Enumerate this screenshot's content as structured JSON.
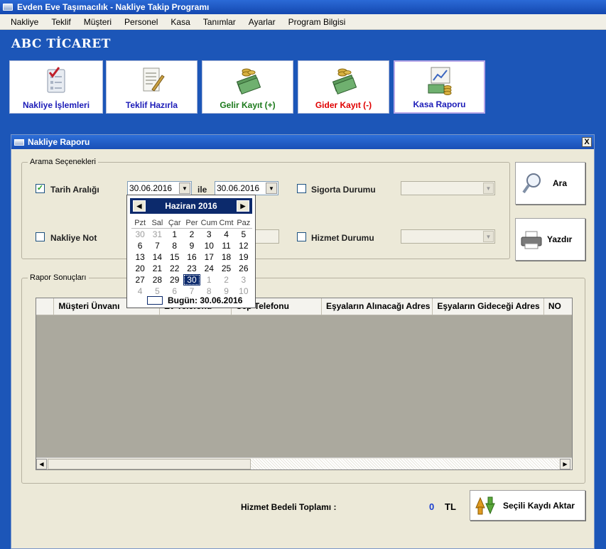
{
  "window": {
    "title": "Evden Eve Taşımacılık - Nakliye Takip Programı"
  },
  "menu": [
    "Nakliye",
    "Teklif",
    "Müşteri",
    "Personel",
    "Kasa",
    "Tanımlar",
    "Ayarlar",
    "Program Bilgisi"
  ],
  "company": "ABC TİCARET",
  "toolbar": [
    {
      "label": "Nakliye İşlemleri",
      "color": "#1c1cb8",
      "icon": "checklist-icon"
    },
    {
      "label": "Teklif Hazırla",
      "color": "#1c1cb8",
      "icon": "document-pen-icon"
    },
    {
      "label": "Gelir Kayıt (+)",
      "color": "#1c7a1c",
      "icon": "money-coins-icon"
    },
    {
      "label": "Gider Kayıt (-)",
      "color": "#e00000",
      "icon": "money-coins-icon"
    },
    {
      "label": "Kasa Raporu",
      "color": "#1c1cb8",
      "icon": "money-chart-icon"
    }
  ],
  "dialog": {
    "title": "Nakliye Raporu",
    "close": "X",
    "search_group": "Arama Seçenekleri",
    "date_range": {
      "label": "Tarih Aralığı",
      "checked": true,
      "from": "30.06.2016",
      "connector": "ile",
      "to": "30.06.2016"
    },
    "insurance": {
      "label": "Sigorta Durumu",
      "checked": false
    },
    "note": {
      "label": "Nakliye Not",
      "checked": false
    },
    "service": {
      "label": "Hizmet Durumu",
      "checked": false
    },
    "search_button": "Ara",
    "print_button": "Yazdır",
    "results_group": "Rapor Sonuçları",
    "columns": [
      "Müşteri Ünvanı",
      "Ev Telefonu",
      "Cep Telefonu",
      "Eşyaların Alınacağı Adres",
      "Eşyaların Gideceği Adres",
      "NO"
    ],
    "total_label": "Hizmet Bedeli Toplamı :",
    "total_value": "0",
    "currency": "TL",
    "transfer_button": "Seçili Kaydı Aktar"
  },
  "calendar": {
    "month": "Haziran 2016",
    "weekdays": [
      "Pzt",
      "Sal",
      "Çar",
      "Per",
      "Cum",
      "Cmt",
      "Paz"
    ],
    "weeks": [
      [
        "30",
        "31",
        "1",
        "2",
        "3",
        "4",
        "5"
      ],
      [
        "6",
        "7",
        "8",
        "9",
        "10",
        "11",
        "12"
      ],
      [
        "13",
        "14",
        "15",
        "16",
        "17",
        "18",
        "19"
      ],
      [
        "20",
        "21",
        "22",
        "23",
        "24",
        "25",
        "26"
      ],
      [
        "27",
        "28",
        "29",
        "30",
        "1",
        "2",
        "3"
      ],
      [
        "4",
        "5",
        "6",
        "7",
        "8",
        "9",
        "10"
      ]
    ],
    "selected": "30",
    "today_label": "Bugün: 30.06.2016"
  }
}
